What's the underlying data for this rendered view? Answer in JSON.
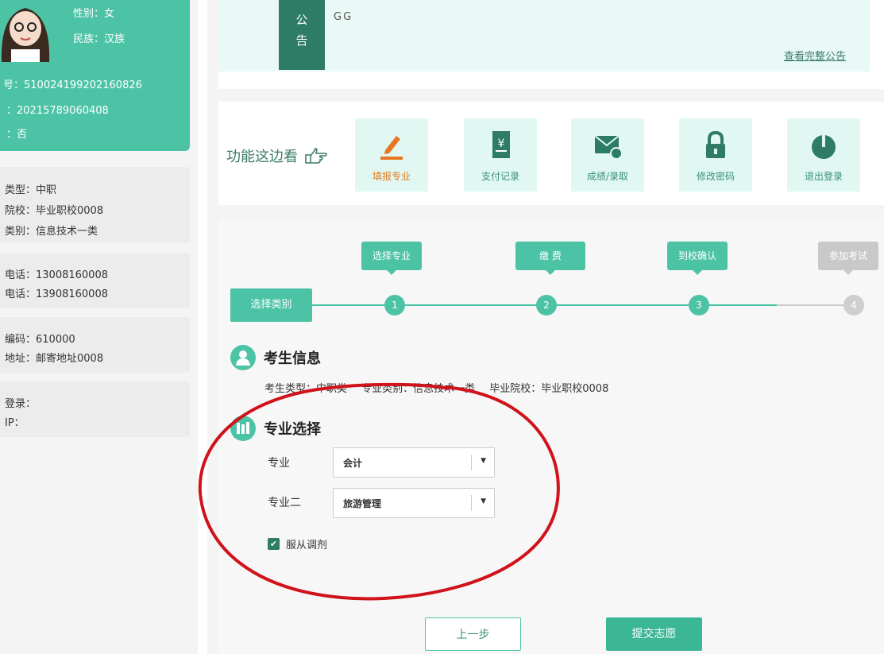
{
  "profile": {
    "gender": "性别：女",
    "ethnicity": "民族：汉族",
    "id_number": "号：510024199202160826",
    "exam_number": "：20215789060408",
    "flag": "：否"
  },
  "info_cards": [
    [
      "类型：中职",
      "院校：毕业职校0008",
      "类别：信息技术一类"
    ],
    [
      "电话：13008160008",
      "电话：13908160008"
    ],
    [
      "编码：610000",
      "地址：邮寄地址0008"
    ],
    [
      "登录：",
      "IP："
    ]
  ],
  "notice": {
    "tag_line1": "公",
    "tag_line2": "告",
    "text": "GG",
    "link": "查看完整公告"
  },
  "functions": {
    "label": "功能这边看",
    "buttons": [
      {
        "label": "填报专业",
        "icon": "pencil-icon"
      },
      {
        "label": "支付记录",
        "icon": "receipt-icon"
      },
      {
        "label": "成绩/录取",
        "icon": "mail-user-icon"
      },
      {
        "label": "修改密码",
        "icon": "lock-icon"
      },
      {
        "label": "退出登录",
        "icon": "power-icon"
      }
    ]
  },
  "steps": {
    "start": "选择类别",
    "labels": [
      "选择专业",
      "缴 费",
      "到校确认",
      "参加考试"
    ],
    "dots": [
      "1",
      "2",
      "3",
      "4"
    ]
  },
  "student_info": {
    "title": "考生信息",
    "line": "考生类型：中职类 专业类别：信息技术一类 毕业院校：毕业职校0008"
  },
  "major": {
    "title": "专业选择",
    "field1_label": "专业",
    "field1_value": "会计",
    "field2_label": "专业二",
    "field2_value": "旅游管理",
    "checkbox_label": "服从调剂",
    "checked": true
  },
  "actions": {
    "prev": "上一步",
    "submit": "提交志愿"
  },
  "colors": {
    "primary": "#4dc3a6",
    "dark": "#2e7c66",
    "annotation": "#d0121b"
  }
}
